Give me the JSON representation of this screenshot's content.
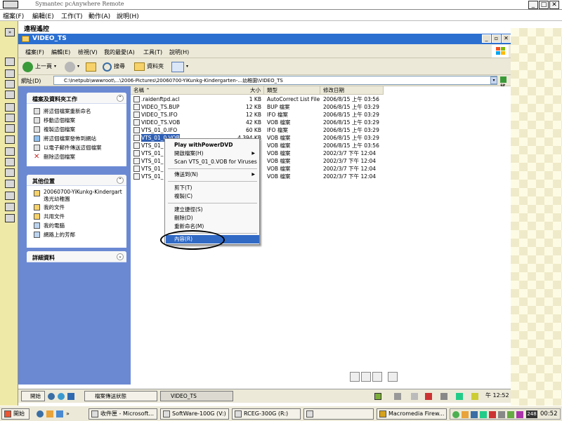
{
  "outer_window": {
    "title": "Symantec pcAnywhere Remote",
    "minimize": "_",
    "maximize": "□",
    "close": "✕"
  },
  "outer_menu": [
    "檔案(F)",
    "編輯(E)",
    "工作(T)",
    "動作(A)",
    "說明(H)"
  ],
  "remote_header": "遠程遙控",
  "explorer": {
    "title": "VIDEO_TS",
    "menu": [
      "檔案(F)",
      "編輯(E)",
      "檢視(V)",
      "我的最愛(A)",
      "工具(T)",
      "說明(H)"
    ],
    "toolbar": {
      "back": "上一頁",
      "search": "搜尋",
      "folders": "資料夾"
    },
    "address": {
      "label": "網址(D)",
      "value": "C:\\Inetpub\\wwwroot\\...\\2006-Pictures\\20060700-YiKunkg-Kindergarten-...幼稚園\\VIDEO_TS",
      "go": "移至"
    }
  },
  "task_pane": {
    "file_tasks": {
      "title": "檔案及資料夾工作",
      "items": [
        "將這個檔案重新命名",
        "移動這個檔案",
        "複製這個檔案",
        "將這個檔案發佈到網站",
        "以電子郵件傳送這個檔案",
        "刪除這個檔案"
      ]
    },
    "other_places": {
      "title": "其他位置",
      "items": [
        "20060700-YiKunkg-Kindergart",
        "逸光幼稚園",
        "我的文件",
        "共用文件",
        "我的電腦",
        "網路上的芳鄰"
      ]
    },
    "details": {
      "title": "詳細資料"
    }
  },
  "file_list": {
    "columns": [
      "名稱",
      "大小",
      "類型",
      "修改日期"
    ],
    "rows": [
      {
        "name": ".raidenftpd.acl",
        "size": "1 KB",
        "type": "AutoCorrect List File",
        "date": "2006/8/15 上午 03:56"
      },
      {
        "name": "VIDEO_TS.BUP",
        "size": "12 KB",
        "type": "BUP 檔案",
        "date": "2006/8/15 上午 03:29"
      },
      {
        "name": "VIDEO_TS.IFO",
        "size": "12 KB",
        "type": "IFO 檔案",
        "date": "2006/8/15 上午 03:29"
      },
      {
        "name": "VIDEO_TS.VOB",
        "size": "42 KB",
        "type": "VOB 檔案",
        "date": "2006/8/15 上午 03:29"
      },
      {
        "name": "VTS_01_0.IFO",
        "size": "60 KB",
        "type": "IFO 檔案",
        "date": "2006/8/15 上午 03:29"
      },
      {
        "name": "VTS_01_0.VOB",
        "size": "4,394 KB",
        "type": "VOB 檔案",
        "date": "2006/8/15 上午 03:29"
      },
      {
        "name": "VTS_01_",
        "size": "",
        "type": "VOB 檔案",
        "date": "2006/8/15 上午 03:56"
      },
      {
        "name": "VTS_01_",
        "size": "",
        "type": "VOB 檔案",
        "date": "2002/3/7 下午 12:04"
      },
      {
        "name": "VTS_01_",
        "size": "",
        "type": "VOB 檔案",
        "date": "2002/3/7 下午 12:04"
      },
      {
        "name": "VTS_01_",
        "size": "",
        "type": "VOB 檔案",
        "date": "2002/3/7 下午 12:04"
      },
      {
        "name": "VTS_01_",
        "size": "",
        "type": "VOB 檔案",
        "date": "2002/3/7 下午 12:04"
      }
    ]
  },
  "context_menu": {
    "items": [
      "Play withPowerDVD",
      "開啟檔案(H)",
      "Scan VTS_01_0.VOB for Viruses",
      "傳送到(N)",
      "剪下(T)",
      "複製(C)",
      "建立捷徑(S)",
      "刪除(D)",
      "重新命名(M)",
      "內容(R)"
    ],
    "highlighted": "內容(R)"
  },
  "inner_taskbar": {
    "start": "開始",
    "tasks": [
      "檔案傳送狀態",
      "VIDEO_TS"
    ],
    "time": "午 12:52"
  },
  "outer_taskbar": {
    "start": "開始",
    "tasks": [
      "收件匣 - Microsoft...",
      "SoftWare-100G (V:)",
      "RCEG-300G (R:)",
      "",
      "Macromedia Firew..."
    ],
    "time": "00:52",
    "tray_badge": "248"
  }
}
